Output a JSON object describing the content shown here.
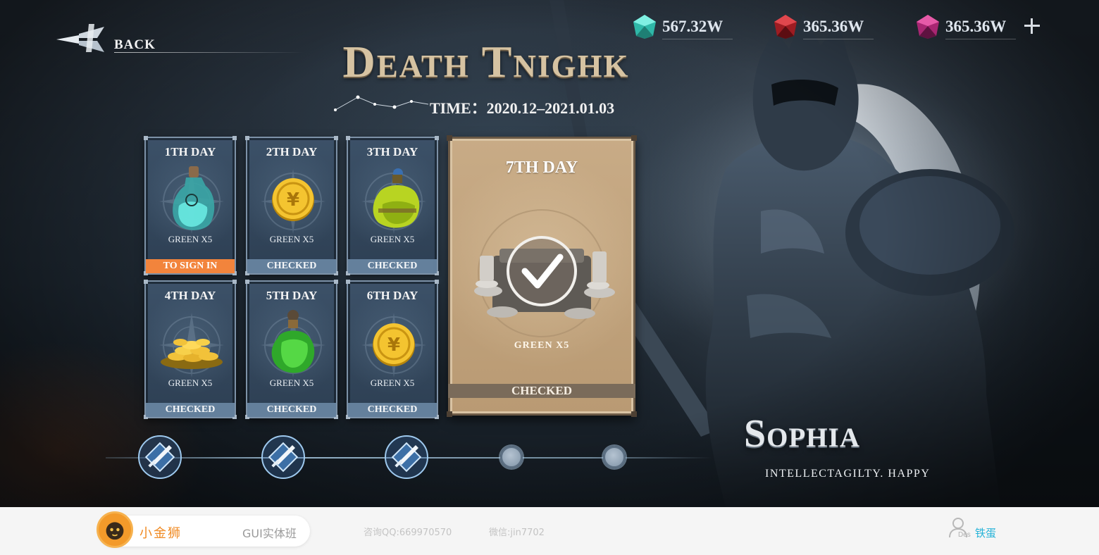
{
  "header": {
    "back_label": "BACK",
    "title": "Death Tnighk",
    "time_text": "TIME：2020.12–2021.01.03"
  },
  "currencies": [
    {
      "value": "567.32W",
      "color": "#3fd6c4"
    },
    {
      "value": "365.36W",
      "color": "#c2262c"
    },
    {
      "value": "365.36W",
      "color": "#c8338a"
    }
  ],
  "days": [
    {
      "label": "1TH DAY",
      "reward": "GREEN X5",
      "status": "TO SIGN IN",
      "item": "potion-bottle-icon"
    },
    {
      "label": "2TH DAY",
      "reward": "GREEN X5",
      "status": "CHECKED",
      "item": "gold-coin-icon"
    },
    {
      "label": "3TH DAY",
      "reward": "GREEN X5",
      "status": "CHECKED",
      "item": "green-potion-icon"
    },
    {
      "label": "4TH DAY",
      "reward": "GREEN X5",
      "status": "CHECKED",
      "item": "coin-pile-icon"
    },
    {
      "label": "5TH DAY",
      "reward": "GREEN X5",
      "status": "CHECKED",
      "item": "green-potion-icon"
    },
    {
      "label": "6TH DAY",
      "reward": "GREEN X5",
      "status": "CHECKED",
      "item": "gold-coin-icon"
    }
  ],
  "day7": {
    "label": "7TH DAY",
    "reward": "GREEN  X5",
    "status": "CHECKED",
    "item": "silver-chest-checked-icon"
  },
  "progress": {
    "completed": 3,
    "total": 5
  },
  "character": {
    "name": "Sophia",
    "subtitle": "INTELLECTAGILTY. HAPPY"
  },
  "footer": {
    "brand": "小金狮",
    "course": "GUI实体班",
    "qq": "咨询QQ:669970570",
    "wechat": "微信:jin7702",
    "user_tag": "Des",
    "user_name": "铁蛋"
  },
  "colors": {
    "accent_orange": "#f2843c",
    "status_blue": "#64809c",
    "card_gold": "#c8ab86",
    "link_cyan": "#26b3d8"
  }
}
